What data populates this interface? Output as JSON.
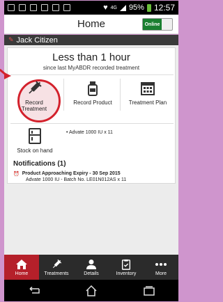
{
  "status": {
    "battery": "95%",
    "time": "12:57",
    "network": "4G"
  },
  "header": {
    "title": "Home",
    "toggle_label": "Online"
  },
  "user": {
    "name": "Jack Citizen"
  },
  "last_treatment": {
    "big": "Less than 1 hour",
    "small": "since last MyABDR recorded treatment"
  },
  "actions": [
    {
      "label_line1": "Record",
      "label_line2": "Treatment",
      "icon": "syringe-icon"
    },
    {
      "label": "Record Product",
      "icon": "vial-icon"
    },
    {
      "label": "Treatment Plan",
      "icon": "calendar-icon"
    }
  ],
  "stock": {
    "label": "Stock on hand",
    "info": "• Advate 1000 IU x 11",
    "icon": "fridge-icon"
  },
  "notifications": {
    "title": "Notifications (1)",
    "items": [
      {
        "line1": "Product Approaching Expiry - 30 Sep 2015",
        "line2": "Advate 1000 IU - Batch No. LE01N012AS x 11",
        "icon": "alarm-icon"
      }
    ]
  },
  "nav": [
    {
      "label": "Home",
      "icon": "home-icon",
      "active": true
    },
    {
      "label": "Treatments",
      "icon": "syringe-icon"
    },
    {
      "label": "Details",
      "icon": "person-icon"
    },
    {
      "label": "Inventory",
      "icon": "clipboard-icon"
    },
    {
      "label": "More",
      "icon": "more-icon"
    }
  ],
  "colors": {
    "accent": "#d3212c",
    "online": "#1a7f30",
    "nav_bg": "#2b2b2b"
  }
}
